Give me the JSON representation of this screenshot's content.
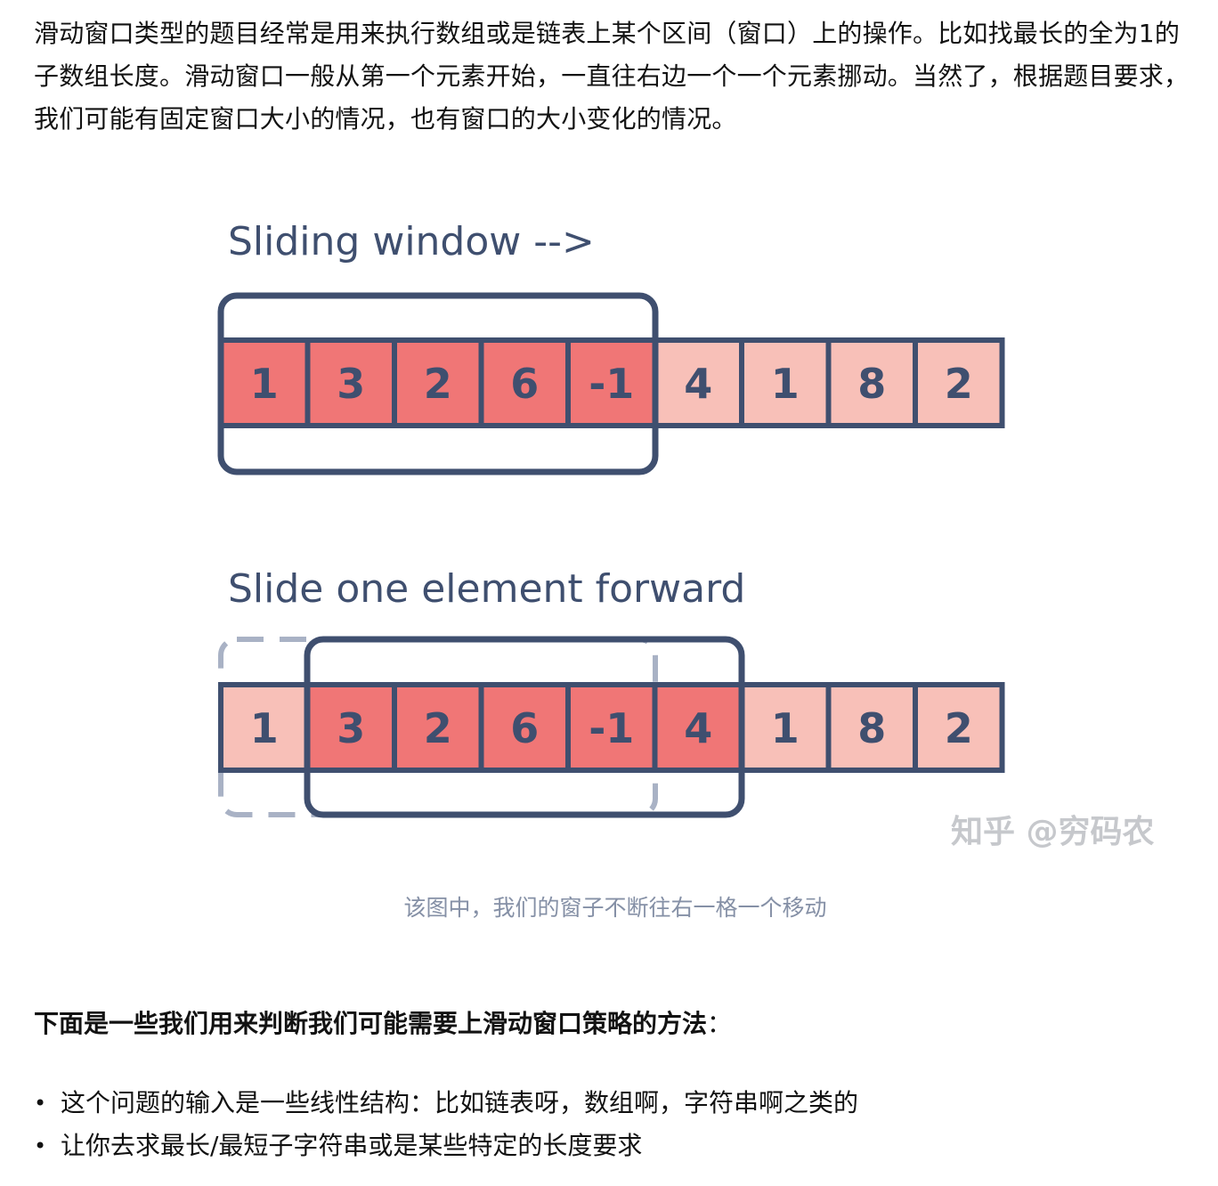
{
  "article": {
    "intro": "滑动窗口类型的题目经常是用来执行数组或是链表上某个区间（窗口）上的操作。比如找最长的全为1的子数组长度。滑动窗口一般从第一个元素开始，一直往右边一个一个元素挪动。当然了，根据题目要求，我们可能有固定窗口大小的情况，也有窗口的大小变化的情况。",
    "lead_bold": "下面是一些我们用来判断我们可能需要上滑动窗口策略的方法",
    "lead_colon": "：",
    "points": [
      "这个问题的输入是一些线性结构：比如链表呀，数组啊，字符串啊之类的",
      "让你去求最长/最短子字符串或是某些特定的长度要求"
    ]
  },
  "figure": {
    "panel1_title": "Sliding window -->",
    "panel2_title": "Slide one element forward",
    "array": [
      "1",
      "3",
      "2",
      "6",
      "-1",
      "4",
      "1",
      "8",
      "2"
    ],
    "panel1_window": [
      0,
      4
    ],
    "panel2_window": [
      1,
      5
    ],
    "watermark": "知乎 @穷码农",
    "caption": "该图中，我们的窗子不断往右一格一个移动",
    "colors": {
      "highlight": "#f07676",
      "normal": "#f8c0b8",
      "border": "#3f4f6f",
      "dashed": "#a9b2c5",
      "title": "#3f4f6f",
      "watermark": "#c6c8cc",
      "caption": "#8590a6"
    }
  }
}
